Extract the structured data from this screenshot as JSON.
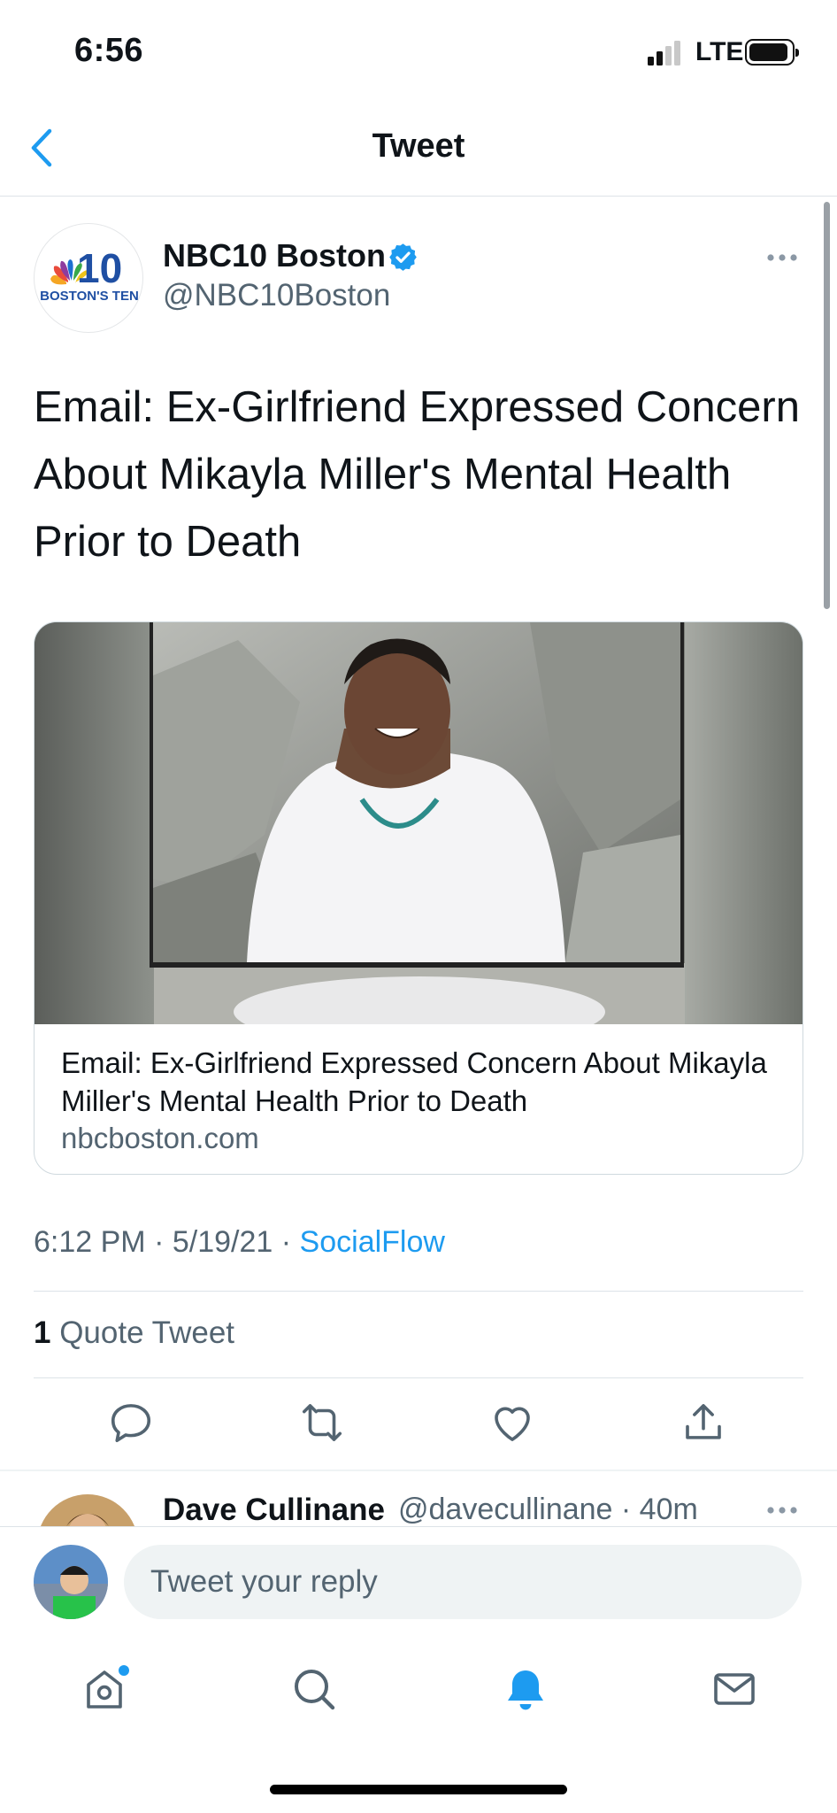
{
  "status_bar": {
    "time": "6:56",
    "network": "LTE"
  },
  "nav": {
    "title": "Tweet"
  },
  "tweet": {
    "author_name": "NBC10 Boston",
    "handle": "@NBC10Boston",
    "logo_number": "10",
    "logo_tagline": "BOSTON'S TEN",
    "text": "Email: Ex-Girlfriend Expressed Concern About Mikayla Miller's Mental Health Prior to Death",
    "card": {
      "title": "Email: Ex-Girlfriend Expressed Concern About Mikayla Miller's Mental Health Prior to Death",
      "domain": "nbcboston.com"
    },
    "time": "6:12 PM",
    "date": "5/19/21",
    "source": "SocialFlow",
    "quote_count": "1",
    "quote_label": "Quote Tweet"
  },
  "reply_preview": {
    "name": "Dave Cullinane",
    "handle_time": "@davecullinane · 40m"
  },
  "composer": {
    "placeholder": "Tweet your reply"
  },
  "colors": {
    "accent": "#1d9bf0",
    "secondary_text": "#536471",
    "divider": "#dde3e8"
  },
  "icons": {
    "actions": [
      "reply-icon",
      "retweet-icon",
      "like-icon",
      "share-icon"
    ],
    "tabs": [
      "home-icon",
      "search-icon",
      "notifications-icon",
      "messages-icon"
    ]
  }
}
